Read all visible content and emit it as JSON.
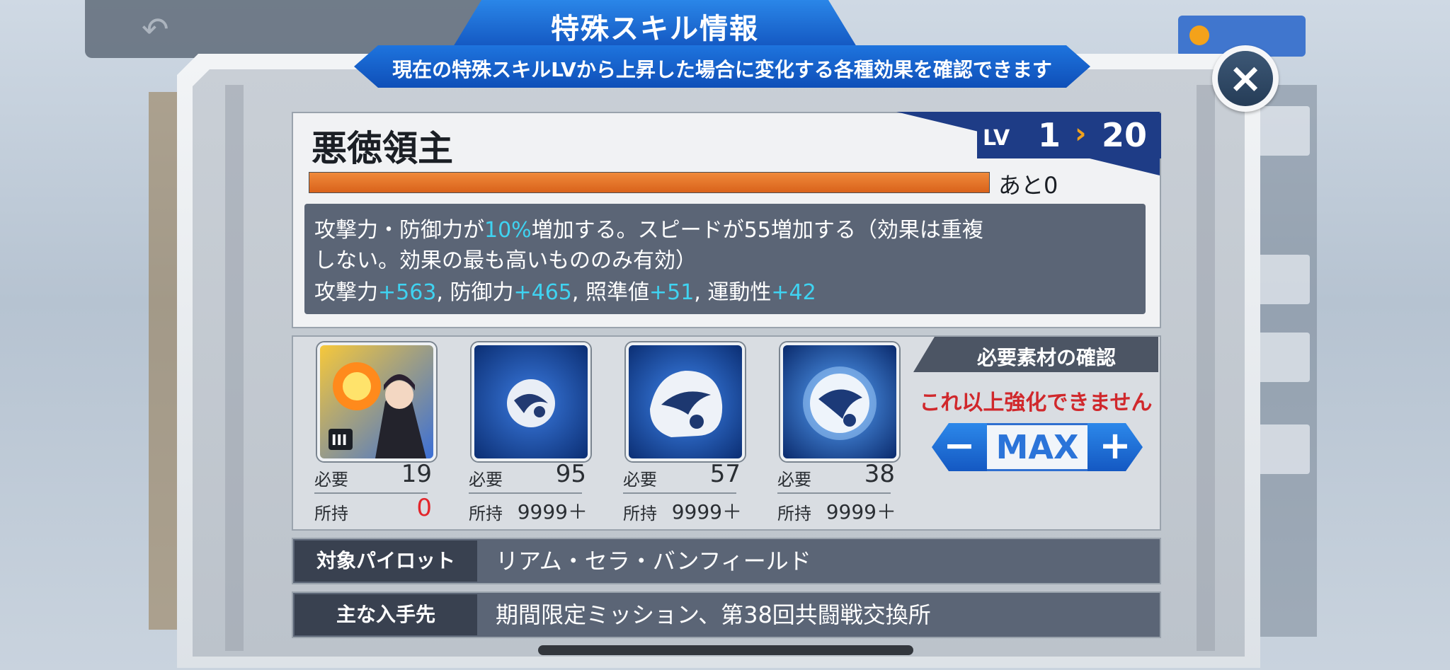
{
  "dialog": {
    "title": "特殊スキル情報",
    "subtitle": "現在の特殊スキルLVから上昇した場合に変化する各種効果を確認できます",
    "close_icon": "close-x-icon"
  },
  "skill": {
    "name": "悪徳領主",
    "lv_label": "LV",
    "lv_current": "1",
    "lv_arrow": "›",
    "lv_max": "20",
    "exp_progress_fraction": 1.0,
    "exp_remaining": "あと0",
    "description": {
      "line1_pre": "攻撃力・防御力が",
      "line1_hl": "10%",
      "line1_post": "増加する。スピードが55増加する（効果は重複",
      "line2": "しない。効果の最も高いもののみ有効）",
      "stats": [
        {
          "name": "攻撃力",
          "value": "+563",
          "sep": ", "
        },
        {
          "name": "防御力",
          "value": "+465",
          "sep": ", "
        },
        {
          "name": "照準値",
          "value": "+51",
          "sep": ", "
        },
        {
          "name": "運動性",
          "value": "+42",
          "sep": ""
        }
      ]
    }
  },
  "materials": {
    "required_label": "必要",
    "owned_label": "所持",
    "items": [
      {
        "icon": "pilot-card-icon",
        "badge": "III",
        "required": "19",
        "owned": "0",
        "owned_short": true
      },
      {
        "icon": "small-orb-icon",
        "required": "95",
        "owned": "9999＋"
      },
      {
        "icon": "medium-orb-icon",
        "required": "57",
        "owned": "9999＋"
      },
      {
        "icon": "large-orb-icon",
        "required": "38",
        "owned": "9999＋"
      }
    ]
  },
  "confirm": {
    "header": "必要素材の確認",
    "status": "これ以上強化できません",
    "minus_label": "−",
    "max_label": "MAX",
    "plus_label": "+"
  },
  "info": {
    "target_label": "対象パイロット",
    "target_value": "リアム・セラ・バンフィールド",
    "source_label": "主な入手先",
    "source_value": "期間限定ミッション、第38回共闘戦交換所"
  },
  "colors": {
    "accent_blue": "#1458c2",
    "highlight_cyan": "#3fd3f1",
    "warning_red": "#d0282c",
    "exp_orange": "#d9621b"
  }
}
